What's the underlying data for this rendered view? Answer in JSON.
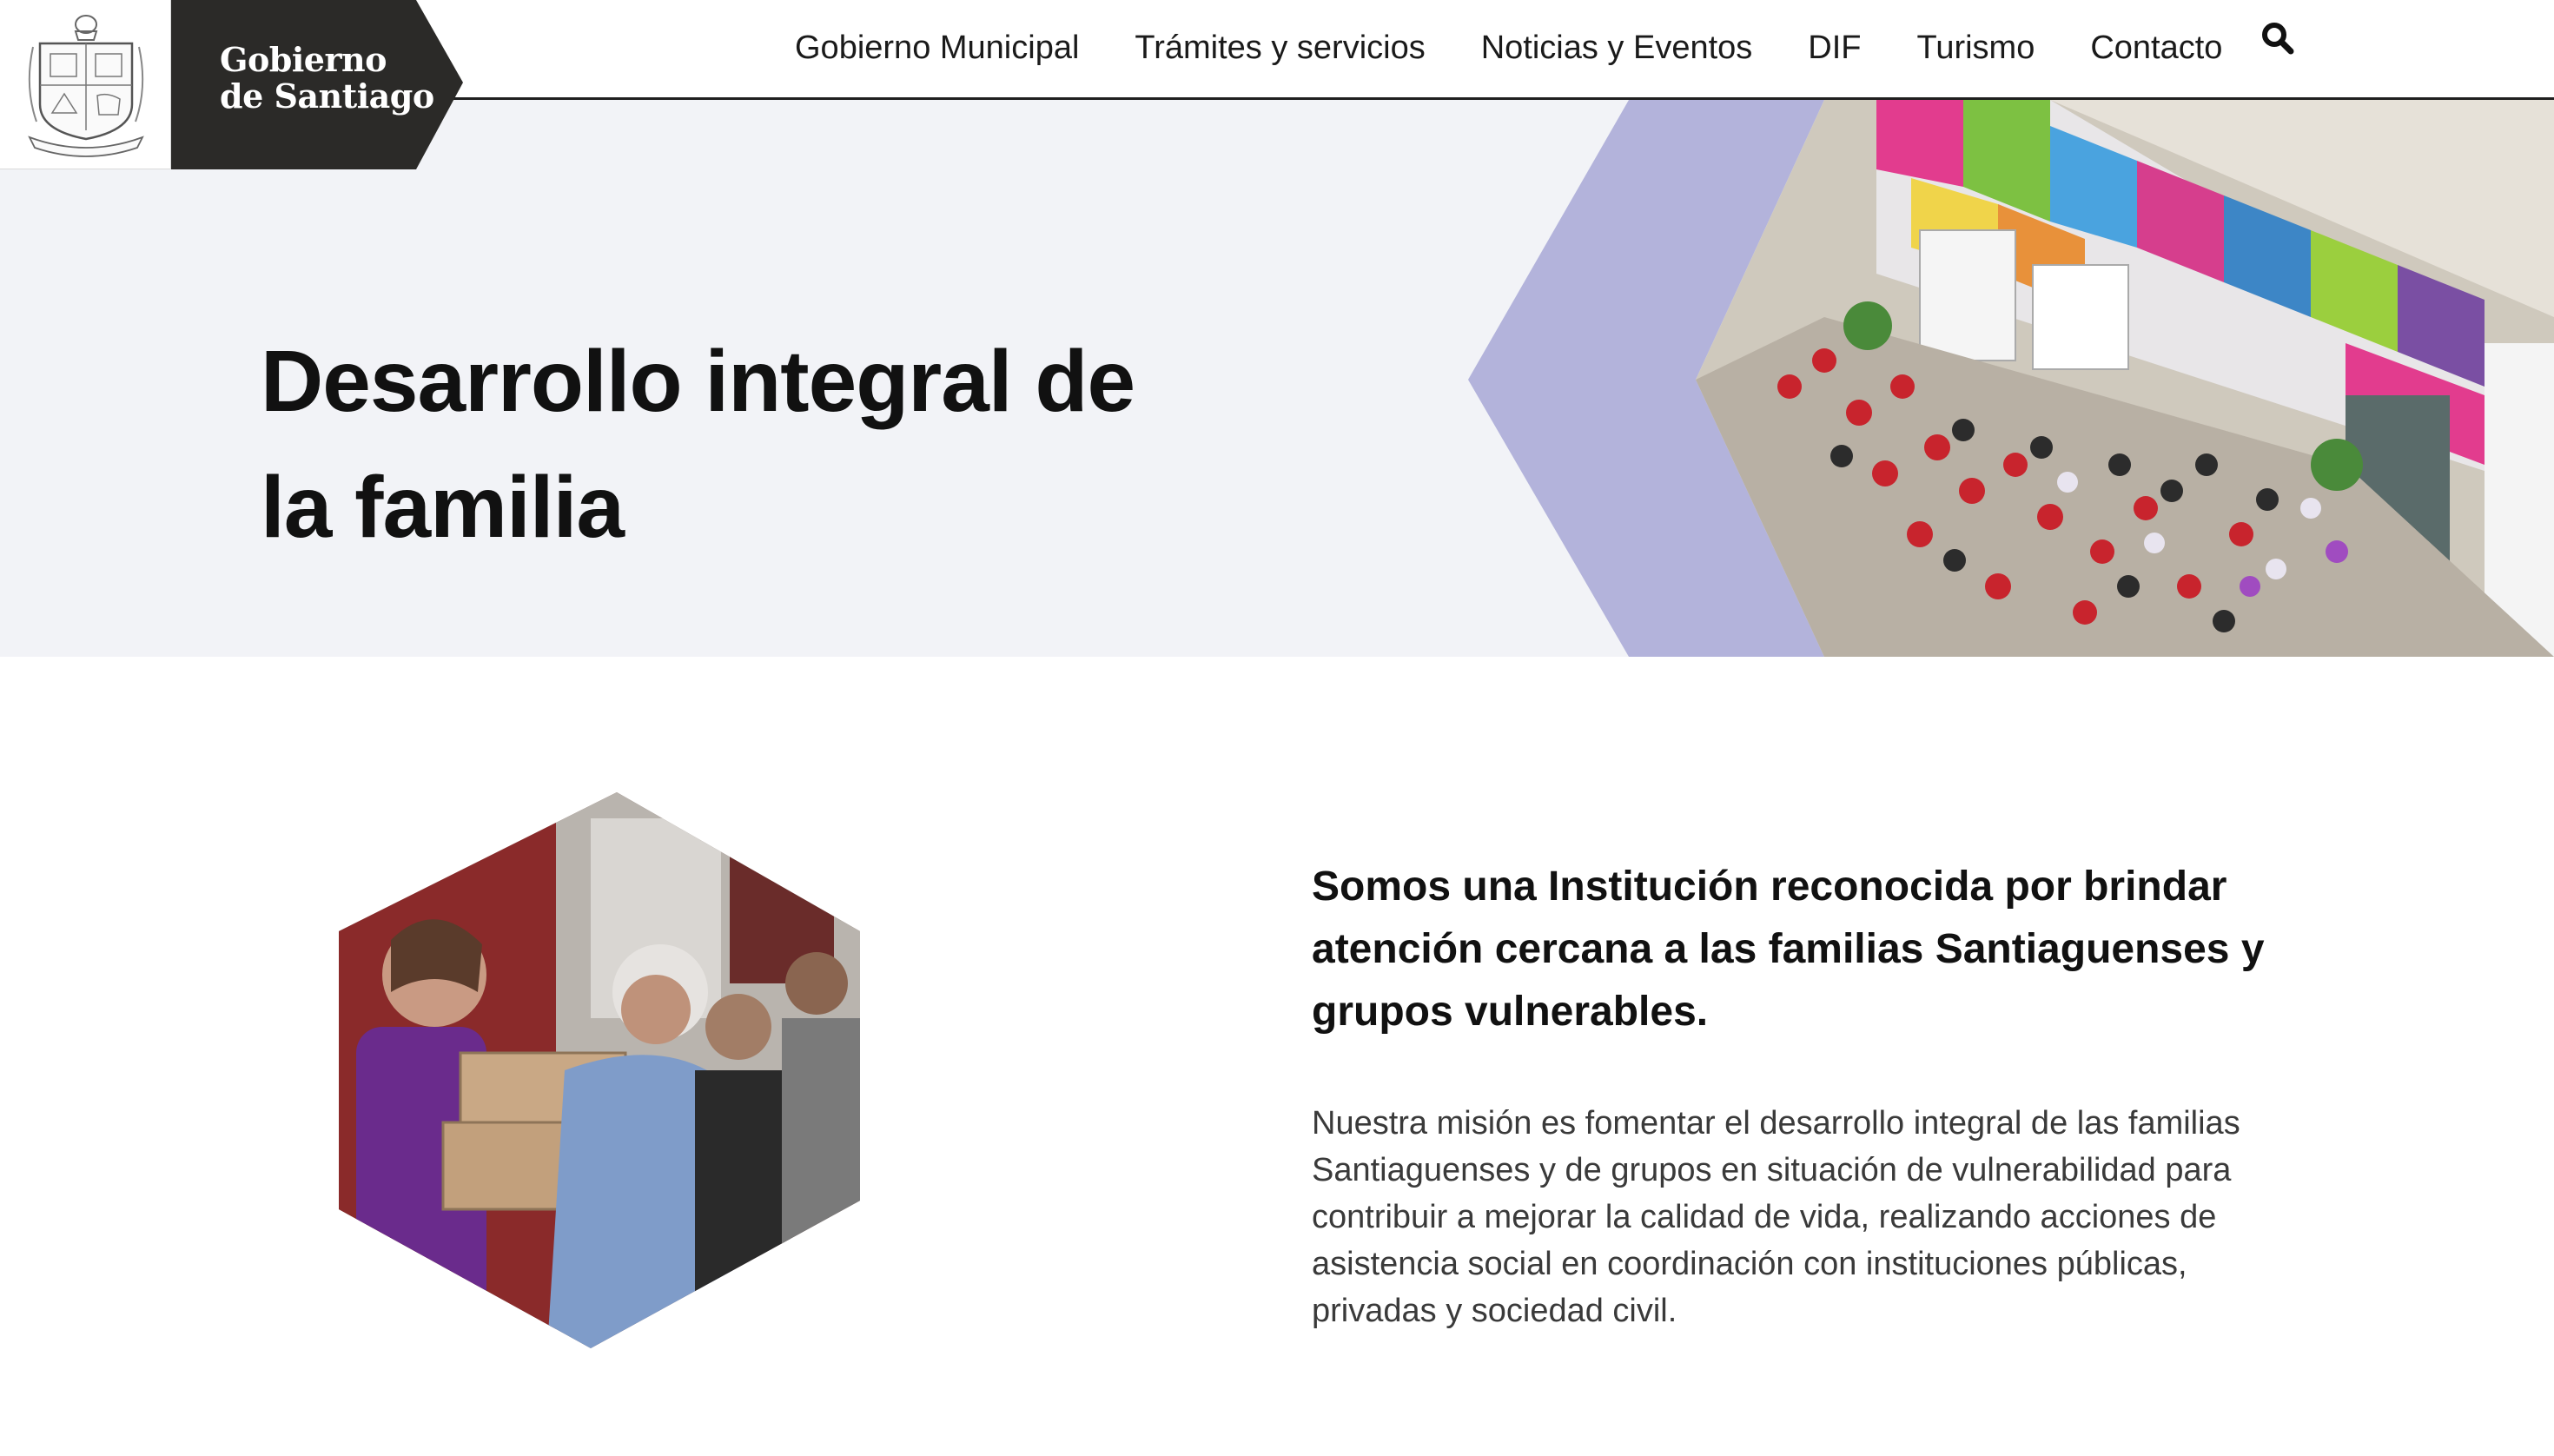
{
  "header": {
    "brand_line1": "Gobierno",
    "brand_line2": "de Santiago",
    "crest_icon": "municipal-crest-icon",
    "nav": [
      {
        "label": "Gobierno Municipal"
      },
      {
        "label": "Trámites y servicios"
      },
      {
        "label": "Noticias y Eventos"
      },
      {
        "label": "DIF"
      },
      {
        "label": "Turismo"
      },
      {
        "label": "Contacto"
      }
    ],
    "search_icon": "search-icon"
  },
  "hero": {
    "title_line1": "Desarrollo integral de",
    "title_line2": "la familia",
    "accent_color": "#b3b3db",
    "background_color": "#f2f3f7"
  },
  "mission": {
    "heading": "Somos una Institución reconocida por brindar atención cercana a las familias Santiaguenses y grupos vulnerables.",
    "body": "Nuestra misión es fomentar el desarrollo integral de las familias Santiaguenses y de grupos en situación de vulnerabilidad para contribuir a mejorar la calidad de vida, realizando acciones de asistencia social en coordinación con instituciones públicas, privadas y sociedad civil."
  },
  "colors": {
    "brand_dark": "#2b2a28",
    "text_dark": "#111111",
    "text_body": "#3a3a3a"
  }
}
